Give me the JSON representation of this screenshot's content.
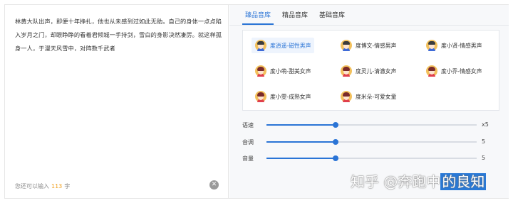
{
  "editor": {
    "text": "林黄大队出声，即便十年挣扎，他也从未感到过如此无助。自己的身体一点点陷入岁月之门，却眼睁睁的看着君倾城一手持剑，雪白的身影决然凄厉。就这样孤身一人，于漫天风雪中，对阵数千武者",
    "count_prefix": "您还可以输入",
    "count_value": "113",
    "count_suffix": "字",
    "clear_icon": "close-circle-icon"
  },
  "tabs": [
    {
      "label": "臻品音库",
      "active": true
    },
    {
      "label": "精品音库",
      "active": false
    },
    {
      "label": "基础音库",
      "active": false
    }
  ],
  "voices": [
    {
      "label": "度逍遥-磁性男声",
      "gender": "male",
      "selected": true
    },
    {
      "label": "度博文-情感男声",
      "gender": "male",
      "selected": false
    },
    {
      "label": "度小贤-情感男声",
      "gender": "male",
      "selected": false
    },
    {
      "label": "度小萌-甜美女声",
      "gender": "female",
      "selected": false
    },
    {
      "label": "度灵儿-清澈女声",
      "gender": "female",
      "selected": false
    },
    {
      "label": "度小乔-情感女声",
      "gender": "female",
      "selected": false
    },
    {
      "label": "度小雯-成熟女声",
      "gender": "female",
      "selected": false
    },
    {
      "label": "度米朵-可爱女童",
      "gender": "female",
      "selected": false
    }
  ],
  "sliders": [
    {
      "label": "语速",
      "value_text": "x5",
      "level": 0.33
    },
    {
      "label": "音调",
      "value_text": "5",
      "level": 0.33
    },
    {
      "label": "音量",
      "value_text": "5",
      "level": 0.33
    }
  ],
  "watermark": {
    "prefix": "知乎 @奔跑中",
    "highlight": "的良知"
  },
  "colors": {
    "accent": "#2a74d6",
    "count_number": "#f0a020",
    "male_body": "#3e6bd8",
    "female_body": "#e0404c"
  }
}
